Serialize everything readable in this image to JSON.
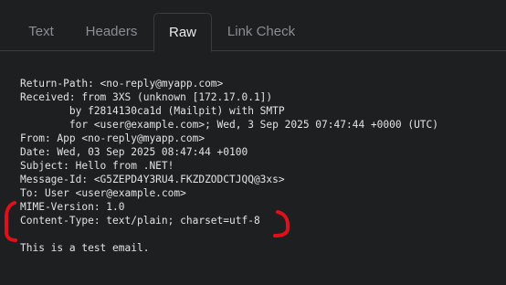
{
  "tabs": [
    {
      "label": "Text",
      "active": false
    },
    {
      "label": "Headers",
      "active": false
    },
    {
      "label": "Raw",
      "active": true
    },
    {
      "label": "Link Check",
      "active": false
    }
  ],
  "raw": {
    "lines": [
      "Return-Path: <no-reply@myapp.com>",
      "Received: from 3XS (unknown [172.17.0.1])",
      "        by f2814130ca1d (Mailpit) with SMTP",
      "        for <user@example.com>; Wed, 3 Sep 2025 07:47:44 +0000 (UTC)",
      "From: App <no-reply@myapp.com>",
      "Date: Wed, 03 Sep 2025 08:47:44 +0100",
      "Subject: Hello from .NET!",
      "Message-Id: <G5ZEPD4Y3RU4.FKZDZODCTJQQ@3xs>",
      "To: User <user@example.com>",
      "MIME-Version: 1.0",
      "Content-Type: text/plain; charset=utf-8",
      "",
      "This is a test email."
    ]
  },
  "colors": {
    "background": "#1e1f21",
    "text": "#e2e3e5",
    "tab_inactive": "#8a8d93",
    "tab_active": "#e9eaec",
    "annotation": "#e0101a"
  }
}
